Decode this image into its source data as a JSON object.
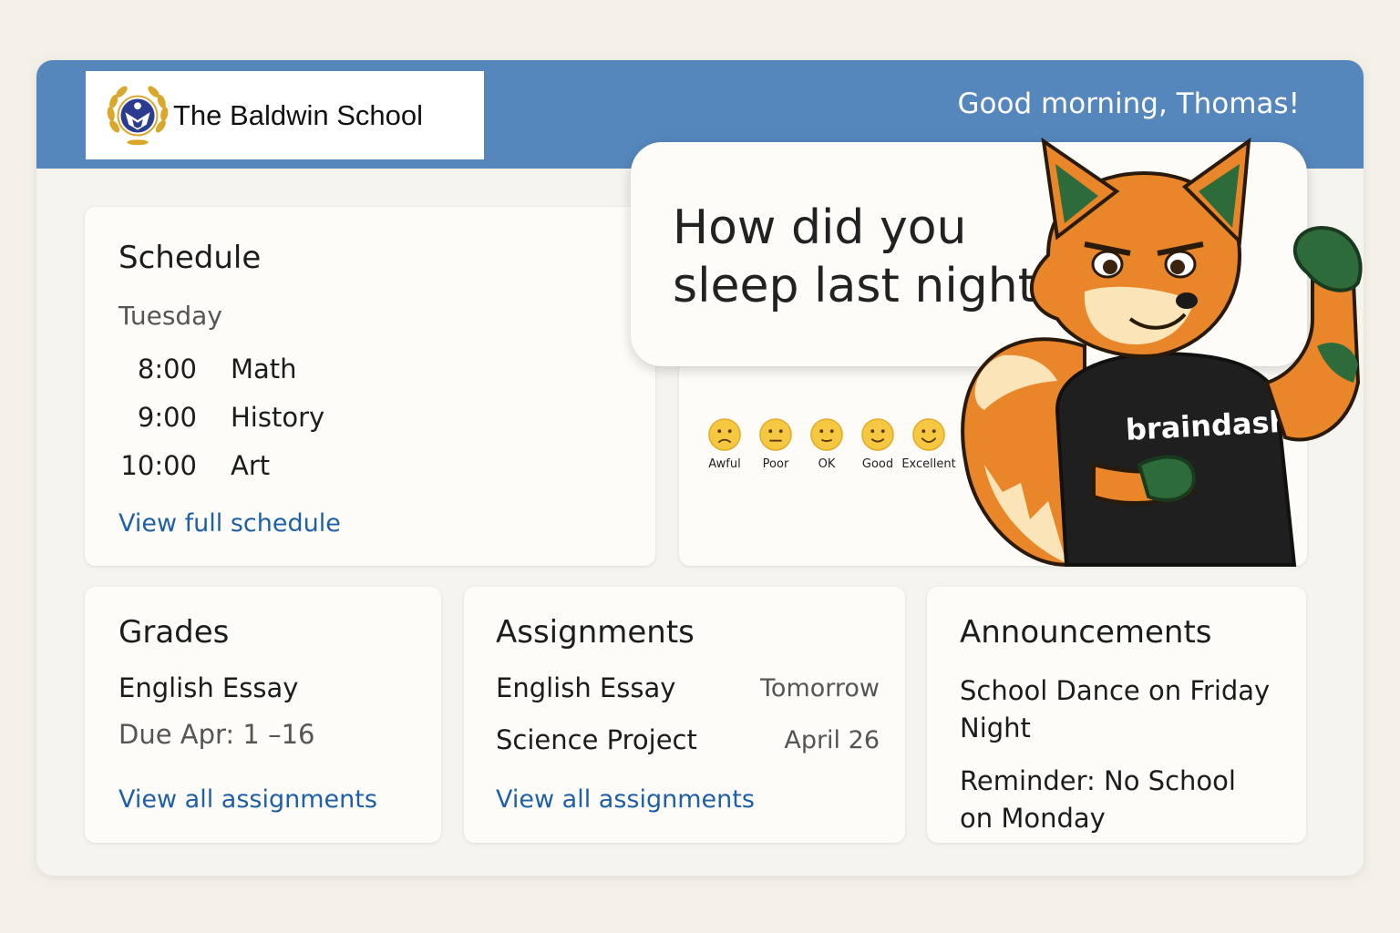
{
  "header": {
    "school_name": "The Baldwin School",
    "greeting": "Good morning, Thomas!"
  },
  "schedule": {
    "title": "Schedule",
    "day": "Tuesday",
    "items": [
      {
        "time": "8:00",
        "subject": "Math"
      },
      {
        "time": "9:00",
        "subject": "History"
      },
      {
        "time": "10:00",
        "subject": "Art"
      }
    ],
    "link": "View full schedule"
  },
  "sleep_prompt": {
    "question_line1": "How did you",
    "question_line2": "sleep last night?",
    "options": [
      "Awful",
      "Poor",
      "OK",
      "Good",
      "Excellent"
    ]
  },
  "mascot": {
    "shirt_text": "braindash",
    "icon": "fox-mascot-icon"
  },
  "grades": {
    "title": "Grades",
    "item": "English Essay",
    "due": "Due Apr: 1 –16",
    "link": "View all assignments"
  },
  "assignments": {
    "title": "Assignments",
    "items": [
      {
        "name": "English Essay",
        "due": "Tomorrow"
      },
      {
        "name": "Science Project",
        "due": "April 26"
      }
    ],
    "link": "View all assignments"
  },
  "announcements": {
    "title": "Announcements",
    "items": [
      {
        "line1": "School Dance on Friday",
        "line2": "Night"
      },
      {
        "line1": "Reminder: No School",
        "line2": "on Monday"
      }
    ]
  },
  "colors": {
    "header": "#5587bd",
    "link": "#1f5fa6",
    "emoji": "#f6c842"
  }
}
